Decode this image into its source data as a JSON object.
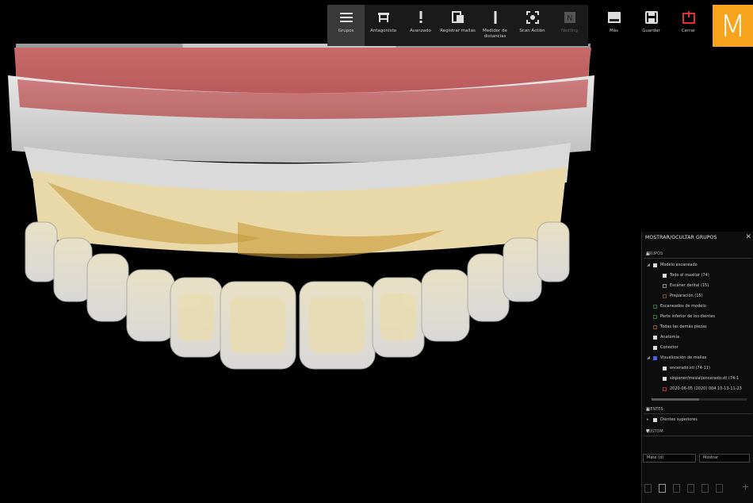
{
  "toolbar": {
    "items": [
      {
        "icon": "menu-icon",
        "label": "Grupos",
        "active": true
      },
      {
        "icon": "articulator-icon",
        "label": "Antagonista"
      },
      {
        "icon": "exclamation-icon",
        "label": "Avanzado"
      },
      {
        "icon": "register-icon",
        "label": "Registrar mallas"
      },
      {
        "icon": "distance-icon",
        "label": "Medidor de distancias"
      },
      {
        "icon": "scan-action-icon",
        "label": "Scan Action"
      },
      {
        "icon": "nesting-icon",
        "label": "Nesting",
        "disabled": true
      }
    ],
    "right_items": [
      {
        "icon": "more-icon",
        "label": "Más"
      },
      {
        "icon": "save-icon",
        "label": "Guardar"
      },
      {
        "icon": "close-icon",
        "label": "Cerrar"
      }
    ],
    "logo_letter": "M",
    "accent": "#f7a31c",
    "close_color": "#e03030"
  },
  "panel": {
    "title": "MOSTRAR/OCULTAR GRUPOS",
    "close_glyph": "✕",
    "sections": {
      "grupos": "GRUPOS",
      "dientes": "DIENTES",
      "custom": "CUSTOM"
    },
    "grupos_items": [
      {
        "label": "Modelo escaneado",
        "indent": 1,
        "caret": "◢",
        "check": "on"
      },
      {
        "label": "Todo el maxilar (74)",
        "indent": 2,
        "check": "on"
      },
      {
        "label": "Escáner dental (15)",
        "indent": 2,
        "check": "off"
      },
      {
        "label": "Preparación (15)",
        "indent": 2,
        "check": "brown"
      },
      {
        "label": "Escaneados de modelo",
        "indent": 1,
        "check": "green"
      },
      {
        "label": "Parte inferior de los dientes",
        "indent": 1,
        "check": "green"
      },
      {
        "label": "Todas las demás piezas",
        "indent": 1,
        "check": "orange"
      },
      {
        "label": "Anatomía",
        "indent": 1,
        "check": "on"
      },
      {
        "label": "Conector",
        "indent": 1,
        "check": "on"
      },
      {
        "label": "Visualización de mallas",
        "indent": 1,
        "caret": "◢",
        "check": "blue"
      },
      {
        "label": "encerado.stl (74-11)",
        "indent": 2,
        "check": "on"
      },
      {
        "label": "sinponer/mesial/encerado.stl (74-1",
        "indent": 2,
        "check": "on"
      },
      {
        "label": "2020-06-05 (2020) 004 10-13-11-23",
        "indent": 2,
        "check": "red"
      }
    ],
    "dientes_items": [
      {
        "label": "Dientes superiores",
        "indent": 1,
        "caret": "▸",
        "check": "on"
      }
    ],
    "field_left": "Mate (d)",
    "field_right": "Mostrar"
  }
}
